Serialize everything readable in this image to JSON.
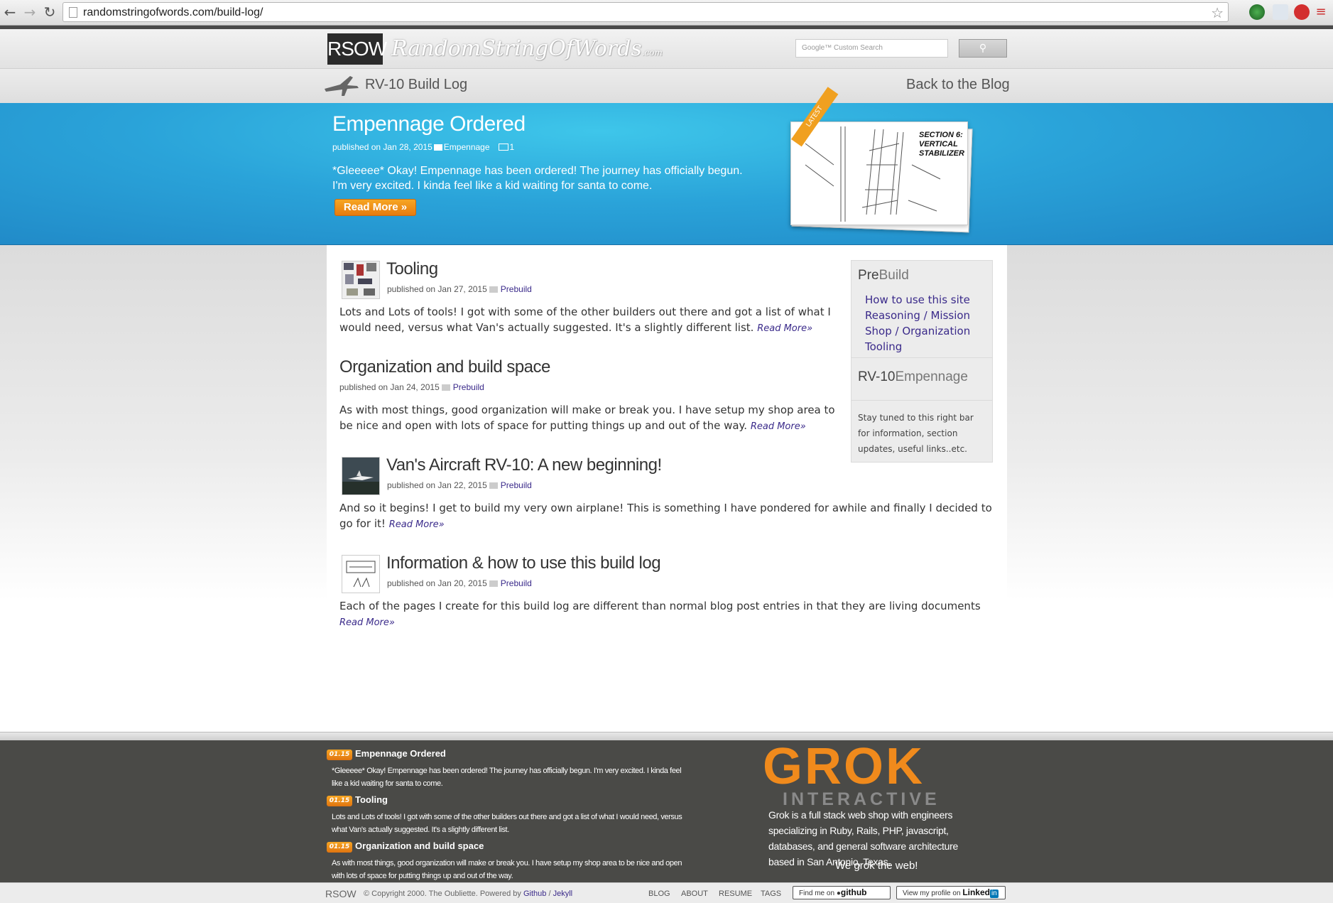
{
  "browser": {
    "url": "randomstringofwords.com/build-log/"
  },
  "site": {
    "logo": "RSOW",
    "logo_script": "RandomStringOfWords",
    "logo_script_suffix": ".com",
    "search_placeholder": "Google™ Custom Search"
  },
  "subnav": {
    "title": "RV-10 Build Log",
    "back": "Back to the Blog"
  },
  "hero": {
    "title": "Empennage Ordered",
    "meta_prefix": "published on Jan 28, 2015",
    "category": "Empennage",
    "image_count": "1",
    "text": "*Gleeeee* Okay! Empennage has been ordered! The journey has officially begun. I'm very excited. I kinda feel like a kid waiting for santa to come.",
    "button": "Read More »",
    "ribbon": "LATEST",
    "card_label": "SECTION 6: VERTICAL STABILIZER"
  },
  "posts": [
    {
      "title": "Tooling",
      "meta": "published on Jan 27, 2015",
      "category": "Prebuild",
      "body": "Lots and Lots of tools! I got with some of the other builders out there and got a list of what I would need, versus what Van's actually suggested. It's a slightly different list.",
      "read_more": "Read More»"
    },
    {
      "title": "Organization and build space",
      "meta": "published on Jan 24, 2015",
      "category": "Prebuild",
      "body": "As with most things, good organization will make or break you. I have setup my shop area to be nice and open with lots of space for putting things up and out of the way.",
      "read_more": "Read More»"
    },
    {
      "title": "Van's Aircraft RV-10: A new beginning!",
      "meta": "published on Jan 22, 2015",
      "category": "Prebuild",
      "body": "And so it begins! I get to build my very own airplane! This is something I have pondered for awhile and finally I decided to go for it!",
      "read_more": "Read More»"
    },
    {
      "title": "Information & how to use this build log",
      "meta": "published on Jan 20, 2015",
      "category": "Prebuild",
      "body": "Each of the pages I create for this build log are different than normal blog post entries in that they are living documents",
      "read_more": "Read More»"
    }
  ],
  "sidebar": {
    "prebuild_a": "Pre",
    "prebuild_b": "Build",
    "links": [
      "How to use this site",
      "Reasoning / Mission",
      "Shop / Organization",
      "Tooling"
    ],
    "rv10_a": "RV-10",
    "rv10_b": "Empennage",
    "note": "Stay tuned to this right bar for information, section updates, useful links..etc."
  },
  "footer": {
    "feed": [
      {
        "date": "01.15",
        "title": "Empennage Ordered",
        "body": "*Gleeeee* Okay! Empennage has been ordered! The journey has officially begun. I'm very excited. I kinda feel like a kid waiting for santa to come."
      },
      {
        "date": "01.15",
        "title": "Tooling",
        "body": "Lots and Lots of tools! I got with some of the other builders out there and got a list of what I would need, versus what Van's actually suggested. It's a slightly different list."
      },
      {
        "date": "01.15",
        "title": "Organization and build space",
        "body": "As with most things, good organization will make or break you. I have setup my shop area to be nice and open with lots of space for putting things up and out of the way."
      }
    ],
    "grok_word": "GROK",
    "grok_sub": "INTERACTIVE",
    "grok_desc": "Grok is a full stack web shop with engineers specializing in Ruby, Rails, PHP, javascript, databases, and general software architecture based in San Antonio, Texas.",
    "grok_tag": "We grok the web!"
  },
  "bottom": {
    "logo": "RSOW",
    "copyright": "© Copyright 2000. The Oubliette. Powered by",
    "github": "Github",
    "slash": "/",
    "jekyll": "Jekyll",
    "nav": [
      "BLOG",
      "ABOUT",
      "RESUME",
      "TAGS"
    ],
    "find_me": "Find me on",
    "github_badge": "github",
    "linkedin_prefix": "View my profile on",
    "linkedin_word": "Linked",
    "linkedin_in": "in"
  },
  "colors": {
    "hero_blue": "#2aa3d9",
    "accent_orange": "#f08a1c",
    "link_purple": "#3a2a8a",
    "footer_dark": "#4a4a47"
  }
}
